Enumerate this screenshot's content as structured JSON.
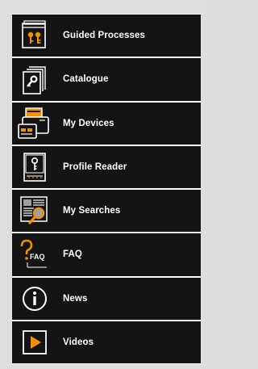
{
  "menu": {
    "items": [
      {
        "label": "Guided Processes",
        "icon": "guided-processes-icon"
      },
      {
        "label": "Catalogue",
        "icon": "catalogue-icon"
      },
      {
        "label": "My Devices",
        "icon": "my-devices-icon"
      },
      {
        "label": "Profile Reader",
        "icon": "profile-reader-icon"
      },
      {
        "label": "My Searches",
        "icon": "my-searches-icon"
      },
      {
        "label": "FAQ",
        "icon": "faq-icon"
      },
      {
        "label": "News",
        "icon": "news-icon"
      },
      {
        "label": "Videos",
        "icon": "videos-icon"
      }
    ]
  },
  "icons": {
    "faq_text": "FAQ"
  },
  "colors": {
    "item_background": "#141414",
    "accent": "#f39200",
    "text": "#ffffff",
    "separator": "#ffffff"
  }
}
